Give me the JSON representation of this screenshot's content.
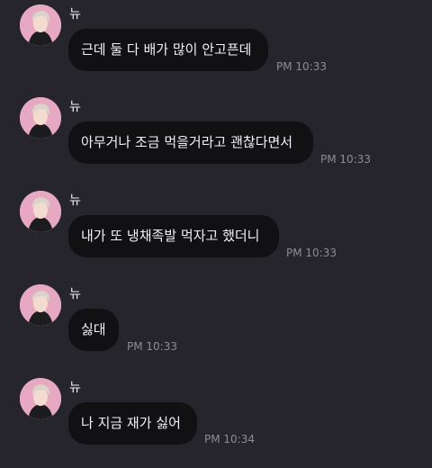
{
  "chat": {
    "messages": [
      {
        "sender": "뉴",
        "text": "근데 둘 다 배가 많이 안고픈데",
        "time": "PM 10:33"
      },
      {
        "sender": "뉴",
        "text": "아무거나 조금 먹을거라고 괜찮다면서",
        "time": "PM 10:33"
      },
      {
        "sender": "뉴",
        "text": "내가 또 냉채족발 먹자고 했더니",
        "time": "PM 10:33"
      },
      {
        "sender": "뉴",
        "text": "싫대",
        "time": "PM 10:33"
      },
      {
        "sender": "뉴",
        "text": "나 지금 재가 싫어",
        "time": "PM 10:34"
      }
    ]
  },
  "colors": {
    "background": "#25252b",
    "bubble": "#111114",
    "text": "#f2f2f2",
    "timestamp": "#8c8c92",
    "avatar_bg": "#e7a9c2"
  },
  "icons": {
    "avatar": "profile-photo"
  }
}
